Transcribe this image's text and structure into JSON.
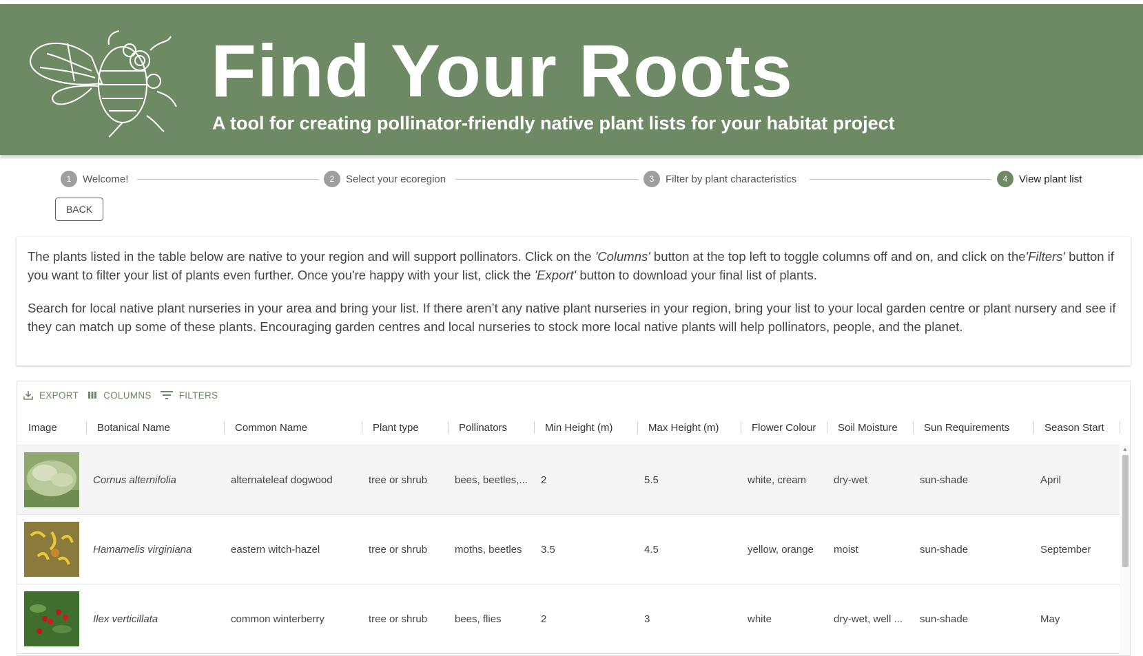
{
  "header": {
    "title": "Find Your Roots",
    "subtitle": "A tool for creating pollinator-friendly native plant lists for your habitat project",
    "logo_icon": "bee-with-flowers-logo"
  },
  "stepper": {
    "steps": [
      {
        "num": "1",
        "label": "Welcome!"
      },
      {
        "num": "2",
        "label": "Select your ecoregion"
      },
      {
        "num": "3",
        "label": "Filter by plant characteristics"
      },
      {
        "num": "4",
        "label": "View plant list"
      }
    ],
    "active_step": 4
  },
  "back_label": "BACK",
  "intro": {
    "p1_a": "The plants listed in the table below are native to your region and will support pollinators. Click on the ",
    "p1_columns": "'Columns'",
    "p1_b": " button at the top left to toggle columns off and on, and click on the",
    "p1_filters": "'Filters'",
    "p1_c": " button if you want to filter your list of plants even further. Once you're happy with your list, click the ",
    "p1_export": "'Export'",
    "p1_d": " button to download your final list of plants.",
    "p2": "Search for local native plant nurseries in your area and bring your list. If there aren’t any native plant nurseries in your region, bring your list to your local garden centre or plant nursery and see if they can match up some of these plants. Encouraging garden centres and local nurseries to stock more local native plants will help pollinators, people, and the planet."
  },
  "toolbar": {
    "export_label": "EXPORT",
    "columns_label": "COLUMNS",
    "filters_label": "FILTERS"
  },
  "table": {
    "columns": [
      "Image",
      "Botanical Name",
      "Common Name",
      "Plant type",
      "Pollinators",
      "Min Height (m)",
      "Max Height (m)",
      "Flower Colour",
      "Soil Moisture",
      "Sun Requirements",
      "Season Start"
    ],
    "rows": [
      {
        "botanical": "Cornus alternifolia",
        "common": "alternateleaf dogwood",
        "type": "tree or shrub",
        "pollinators": "bees, beetles,...",
        "min_h": "2",
        "max_h": "5.5",
        "colour": "white, cream",
        "moisture": "dry-wet",
        "sun": "sun-shade",
        "season": "April",
        "image": "dogwood-photo"
      },
      {
        "botanical": "Hamamelis virginiana",
        "common": "eastern witch-hazel",
        "type": "tree or shrub",
        "pollinators": "moths, beetles",
        "min_h": "3.5",
        "max_h": "4.5",
        "colour": "yellow, orange",
        "moisture": "moist",
        "sun": "sun-shade",
        "season": "September",
        "image": "witch-hazel-photo"
      },
      {
        "botanical": "Ilex verticillata",
        "common": "common winterberry",
        "type": "tree or shrub",
        "pollinators": "bees, flies",
        "min_h": "2",
        "max_h": "3",
        "colour": "white",
        "moisture": "dry-wet, well ...",
        "sun": "sun-shade",
        "season": "May",
        "image": "winterberry-photo"
      }
    ]
  },
  "colors": {
    "brand_green": "#6d8a64",
    "header_text": "#ffffff"
  }
}
